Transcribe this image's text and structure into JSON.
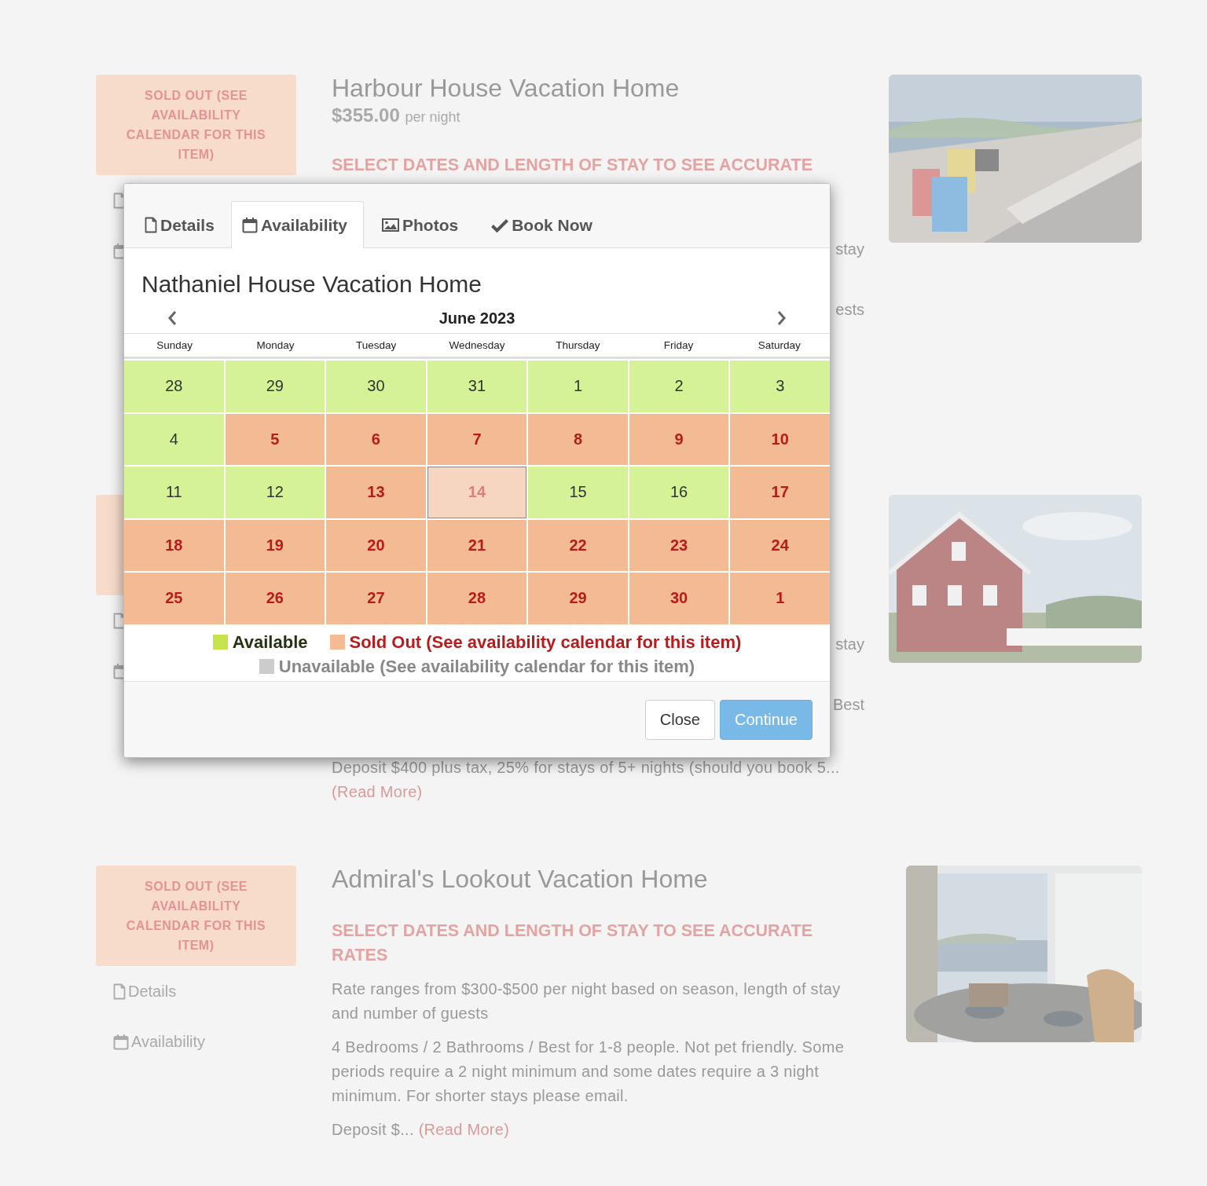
{
  "listings": [
    {
      "badge": "SOLD OUT (SEE AVAILABILITY CALENDAR FOR THIS ITEM)",
      "title": "Harbour House Vacation Home",
      "price": "$355.00",
      "price_unit": "per night",
      "rates_heading": "SELECT DATES AND LENGTH OF STAY TO SEE ACCURATE",
      "fragments": [
        "stay",
        "ests"
      ],
      "image": {
        "kind": "picture"
      }
    },
    {
      "fragments": [
        "stay",
        "Best"
      ],
      "deposit": "Deposit $400 plus tax, 25% for stays of 5+ nights (should you book 5...",
      "read_more": "(Read More)",
      "image": {
        "kind": "picture"
      }
    },
    {
      "badge": "SOLD OUT (SEE AVAILABILITY CALENDAR FOR THIS ITEM)",
      "links": [
        "Details",
        "Availability"
      ],
      "title": "Admiral's Lookout Vacation Home",
      "rates_heading": "SELECT DATES AND LENGTH OF STAY TO SEE ACCURATE RATES",
      "paragraphs": [
        "Rate ranges from $300-$500 per night based on season, length of stay and number of guests",
        "4 Bedrooms / 2 Bathrooms / Best for 1-8 people. Not pet friendly. Some periods require a 2 night minimum and some dates require a 3 night minimum. For shorter stays please email."
      ],
      "deposit": "Deposit $...",
      "read_more": "(Read More)",
      "image": {
        "kind": "picture"
      }
    }
  ],
  "modal": {
    "tabs": [
      {
        "label": "Details",
        "selected": false
      },
      {
        "label": "Availability",
        "selected": true
      },
      {
        "label": "Photos",
        "selected": false
      },
      {
        "label": "Book Now",
        "selected": false
      }
    ],
    "title": "Nathaniel House Vacation Home",
    "month": "June 2023",
    "weekdays": [
      "Sunday",
      "Monday",
      "Tuesday",
      "Wednesday",
      "Thursday",
      "Friday",
      "Saturday"
    ],
    "weeks": [
      [
        {
          "day": "28",
          "kind": "available",
          "selected": false
        },
        {
          "day": "29",
          "kind": "available",
          "selected": false
        },
        {
          "day": "30",
          "kind": "available",
          "selected": false
        },
        {
          "day": "31",
          "kind": "available",
          "selected": false
        },
        {
          "day": "1",
          "kind": "available",
          "selected": false
        },
        {
          "day": "2",
          "kind": "available",
          "selected": false
        },
        {
          "day": "3",
          "kind": "available",
          "selected": false
        }
      ],
      [
        {
          "day": "4",
          "kind": "available",
          "selected": false
        },
        {
          "day": "5",
          "kind": "soldout",
          "selected": false
        },
        {
          "day": "6",
          "kind": "soldout",
          "selected": false
        },
        {
          "day": "7",
          "kind": "soldout",
          "selected": false
        },
        {
          "day": "8",
          "kind": "soldout",
          "selected": false
        },
        {
          "day": "9",
          "kind": "soldout",
          "selected": false
        },
        {
          "day": "10",
          "kind": "soldout",
          "selected": false
        }
      ],
      [
        {
          "day": "11",
          "kind": "available",
          "selected": false
        },
        {
          "day": "12",
          "kind": "available",
          "selected": false
        },
        {
          "day": "13",
          "kind": "soldout",
          "selected": false
        },
        {
          "day": "14",
          "kind": "soldout",
          "selected": true
        },
        {
          "day": "15",
          "kind": "available",
          "selected": false
        },
        {
          "day": "16",
          "kind": "available",
          "selected": false
        },
        {
          "day": "17",
          "kind": "soldout",
          "selected": false
        }
      ],
      [
        {
          "day": "18",
          "kind": "soldout",
          "selected": false
        },
        {
          "day": "19",
          "kind": "soldout",
          "selected": false
        },
        {
          "day": "20",
          "kind": "soldout",
          "selected": false
        },
        {
          "day": "21",
          "kind": "soldout",
          "selected": false
        },
        {
          "day": "22",
          "kind": "soldout",
          "selected": false
        },
        {
          "day": "23",
          "kind": "soldout",
          "selected": false
        },
        {
          "day": "24",
          "kind": "soldout",
          "selected": false
        }
      ],
      [
        {
          "day": "25",
          "kind": "soldout",
          "selected": false
        },
        {
          "day": "26",
          "kind": "soldout",
          "selected": false
        },
        {
          "day": "27",
          "kind": "soldout",
          "selected": false
        },
        {
          "day": "28",
          "kind": "soldout",
          "selected": false
        },
        {
          "day": "29",
          "kind": "soldout",
          "selected": false
        },
        {
          "day": "30",
          "kind": "soldout",
          "selected": false
        },
        {
          "day": "1",
          "kind": "soldout",
          "selected": false
        }
      ]
    ],
    "legend": [
      {
        "label": "Available",
        "kind": "available",
        "color": "#c5e34a"
      },
      {
        "label": "Sold Out (See availability calendar for this item)",
        "kind": "soldout",
        "color": "#f4bb95"
      },
      {
        "label": "Unavailable (See availability calendar for this item)",
        "kind": "unavailable",
        "color": "#cccccc"
      }
    ],
    "buttons": [
      {
        "label": "Close",
        "kind": "default"
      },
      {
        "label": "Continue",
        "kind": "primary"
      }
    ]
  }
}
